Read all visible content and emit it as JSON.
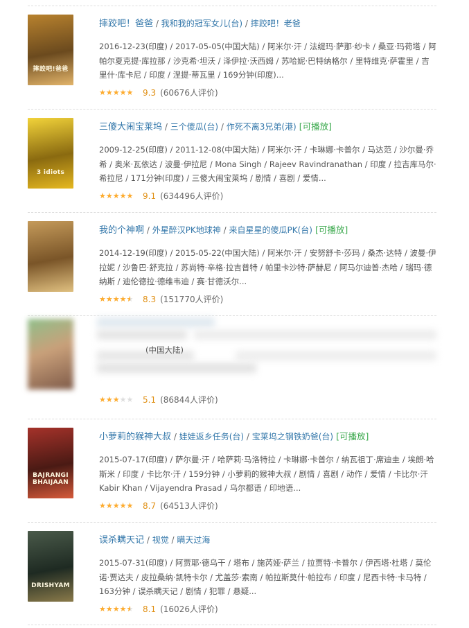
{
  "colors": {
    "link": "#3377aa",
    "playable": "#3ba94d",
    "star": "#ffac2d",
    "score": "#e09015"
  },
  "star_glyphs": "★★★★★",
  "movies": [
    {
      "title": "摔跤吧！爸爸",
      "aliases": [
        "我和我的冠军女儿(台)",
        "摔跤吧！老爸"
      ],
      "playable": "",
      "meta": "2016-12-23(印度) / 2017-05-05(中国大陆) / 阿米尔·汗 / 法缇玛·萨那·纱卡 / 桑亚·玛荷塔 / 阿帕尔夏克提·库拉那 / 沙克希·坦沃 / 泽伊拉·沃西姆 / 苏哈妮·巴特纳格尔 / 里特维克·萨霍里 / 吉里什·库卡尼 / 印度 / 涅提·蒂瓦里 / 169分钟(印度)...",
      "score": "9.3",
      "rating_fraction": 1.0,
      "votes": "(60676人评价)",
      "poster_text": "摔跤吧!爸爸",
      "poster_colors": [
        "#b8822e",
        "#6b4a1e",
        "#e2b46a"
      ]
    },
    {
      "title": "三傻大闹宝莱坞",
      "aliases": [
        "三个傻瓜(台)",
        "作死不离3兄弟(港)"
      ],
      "playable": "[可播放]",
      "meta": "2009-12-25(印度) / 2011-12-08(中国大陆) / 阿米尔·汗 / 卡琳娜·卡普尔 / 马达范 / 沙尔曼·乔希 / 奥米·瓦依达 / 波曼·伊拉尼 / Mona Singh / Rajeev Ravindranathan / 印度 / 拉吉库马尔·希拉尼 / 171分钟(印度) / 三傻大闹宝莱坞 / 剧情 / 喜剧 / 爱情...",
      "score": "9.1",
      "rating_fraction": 0.9,
      "votes": "(634496人评价)",
      "poster_text": "3 idiots",
      "poster_colors": [
        "#f2d33a",
        "#8a6a10",
        "#e6b820"
      ]
    },
    {
      "title": "我的个神啊",
      "aliases": [
        "外星醉汉PK地球神",
        "来自星星的傻瓜PK(台)"
      ],
      "playable": "[可播放]",
      "meta": "2014-12-19(印度) / 2015-05-22(中国大陆) / 阿米尔·汗 / 安努舒卡·莎玛 / 桑杰·达特 / 波曼·伊拉妮 / 沙鲁巴·舒克拉 / 苏尚特·辛格·拉吉普特 / 帕里卡沙特·萨赫尼 / 阿马尔迪普·杰哈 / 瑞玛·德纳斯 / 迪伦德拉·德维韦迪 / 赛·甘德沃尔...",
      "score": "8.3",
      "rating_fraction": 0.8,
      "votes": "(151770人评价)",
      "poster_text": "",
      "poster_colors": [
        "#c49a5a",
        "#7a5528",
        "#e0c080"
      ]
    },
    {
      "title": "",
      "aliases": [],
      "playable": "",
      "meta": "(中国大陆)",
      "score": "5.1",
      "rating_fraction": 0.5,
      "votes": "(86844人评价)",
      "poster_text": "",
      "poster_colors": [
        "#8fbf8a",
        "#c9a07a",
        "#7e5a48"
      ]
    },
    {
      "title": "小萝莉的猴神大叔",
      "aliases": [
        "娃娃返乡任务(台)",
        "宝莱坞之钢铁奶爸(台)"
      ],
      "playable": "[可播放]",
      "meta": "2015-07-17(印度) / 萨尔曼·汗 / 哈萨莉·马洛特拉 / 卡琳娜·卡普尔 / 纳瓦祖丁·席迪圭 / 埃朗·哈斯米 / 印度 / 卡比尔·汗 / 159分钟 / 小萝莉的猴神大叔 / 剧情 / 喜剧 / 动作 / 爱情 / 卡比尔·汗 Kabir Khan / Vijayendra Prasad / 乌尔都语 / 印地语...",
      "score": "8.7",
      "rating_fraction": 0.9,
      "votes": "(64513人评价)",
      "poster_text": "BAJRANGI BHAIJAAN",
      "poster_colors": [
        "#a5322a",
        "#4a1a14",
        "#d65a3a"
      ]
    },
    {
      "title": "误杀瞒天记",
      "aliases": [
        "视觉",
        "瞒天过海"
      ],
      "playable": "",
      "meta": "2015-07-31(印度) / 阿贾耶·德乌干 / 塔布 / 施芮娅·萨兰 / 拉贾特·卡普尔 / 伊西塔·杜塔 / 莫伦诺·贾达夫 / 皮拉桑纳·凯特卡尔 / 尤盖莎·索南 / 帕拉斯莫什·帕拉布 / 印度 / 尼西卡特·卡马特 / 163分钟 / 误杀瞒天记 / 剧情 / 犯罪 / 悬疑...",
      "score": "8.1",
      "rating_fraction": 0.8,
      "votes": "(16026人评价)",
      "poster_text": "DRISHYAM",
      "poster_colors": [
        "#4a5a4a",
        "#1e2a22",
        "#8a7a4a"
      ]
    }
  ]
}
